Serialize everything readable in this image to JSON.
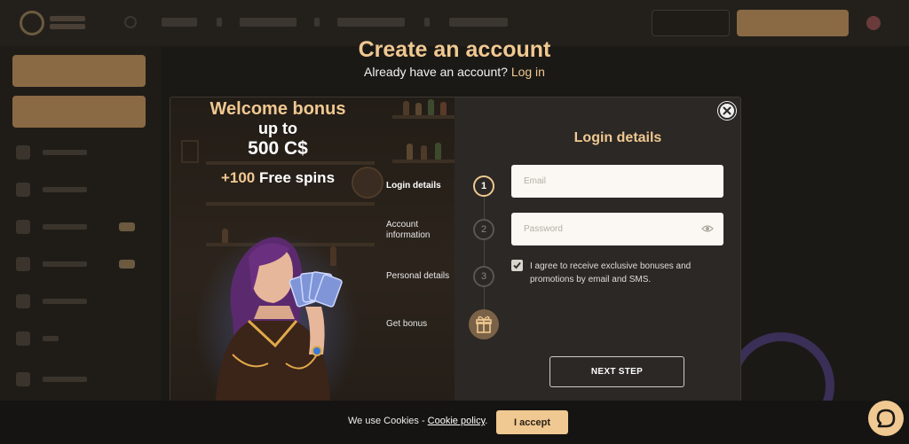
{
  "page": {
    "title": "Create an account",
    "already_text": "Already have an account?",
    "login_link": "Log in"
  },
  "promo": {
    "title": "Welcome bonus",
    "up_to": "up to",
    "amount": "500 C$",
    "spins_plus": "+100",
    "spins_text": "Free spins"
  },
  "steps": [
    {
      "label": "Login details",
      "number": "1",
      "active": true
    },
    {
      "label": "Account information",
      "number": "2",
      "active": false
    },
    {
      "label": "Personal details",
      "number": "3",
      "active": false
    },
    {
      "label": "Get bonus",
      "icon": "gift-icon",
      "active": false
    }
  ],
  "form": {
    "title": "Login details",
    "email_placeholder": "Email",
    "email_value": "",
    "password_placeholder": "Password",
    "password_value": "",
    "agree_checked": true,
    "agree_text": "I agree to receive exclusive bonuses and promotions by email and SMS.",
    "next_label": "NEXT STEP",
    "close_icon": "close-icon",
    "eye_icon": "eye-icon"
  },
  "cookie": {
    "text_prefix": "We use Cookies - ",
    "link": "Cookie policy",
    "text_suffix": ".",
    "accept_label": "I accept"
  },
  "chat": {
    "icon": "chat-icon"
  },
  "colors": {
    "accent": "#f0c891",
    "modal_bg": "#2b2825",
    "page_bg": "#1b1916",
    "field_bg": "#fbf8f3"
  }
}
